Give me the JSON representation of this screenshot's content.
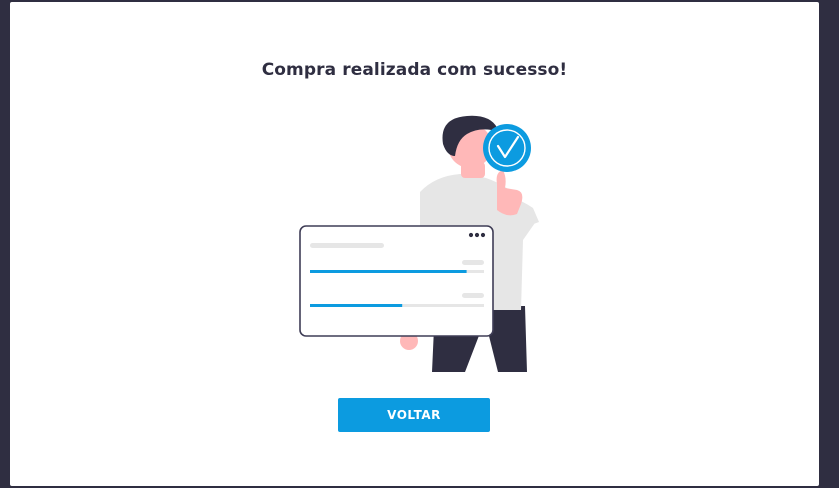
{
  "modal": {
    "title": "Compra realizada com sucesso!",
    "button_label": "VOLTAR"
  },
  "illustration": {
    "icons": [
      "person-thumbs-up",
      "checkmark-icon",
      "more-dots-icon"
    ],
    "card_bars": [
      {
        "progress": 0.9
      },
      {
        "progress": 0.53
      }
    ]
  },
  "colors": {
    "accent": "#0c9be0",
    "dark": "#2f2e41",
    "skin": "#ffb8b8",
    "shirt": "#e6e6e6",
    "backdrop": "#2f2e41"
  }
}
